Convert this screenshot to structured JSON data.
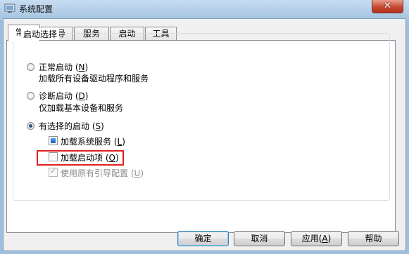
{
  "window": {
    "title": "系统配置",
    "close_glyph": "✕"
  },
  "tabs": [
    "常规",
    "引导",
    "服务",
    "启动",
    "工具"
  ],
  "group": {
    "title": "启动选择",
    "normal": {
      "label": "正常启动",
      "mnemonic": "N",
      "desc": "加载所有设备驱动程序和服务",
      "selected": false
    },
    "diagnostic": {
      "label": "诊断启动",
      "mnemonic": "D",
      "desc": "仅加载基本设备和服务",
      "selected": false
    },
    "selective": {
      "label": "有选择的启动",
      "mnemonic": "S",
      "selected": true
    },
    "options": [
      {
        "label": "加载系统服务",
        "mnemonic": "L",
        "state": "indeterminate",
        "enabled": true
      },
      {
        "label": "加载启动项",
        "mnemonic": "O",
        "state": "unchecked",
        "enabled": true
      },
      {
        "label": "使用原有引导配置",
        "mnemonic": "U",
        "state": "checked",
        "enabled": false
      }
    ]
  },
  "buttons": {
    "ok": "确定",
    "cancel": "取消",
    "apply": "应用",
    "apply_mnemonic": "A",
    "help": "帮助"
  },
  "colors": {
    "highlight": "#e02020",
    "radio_dot": "#2e4e8a"
  }
}
